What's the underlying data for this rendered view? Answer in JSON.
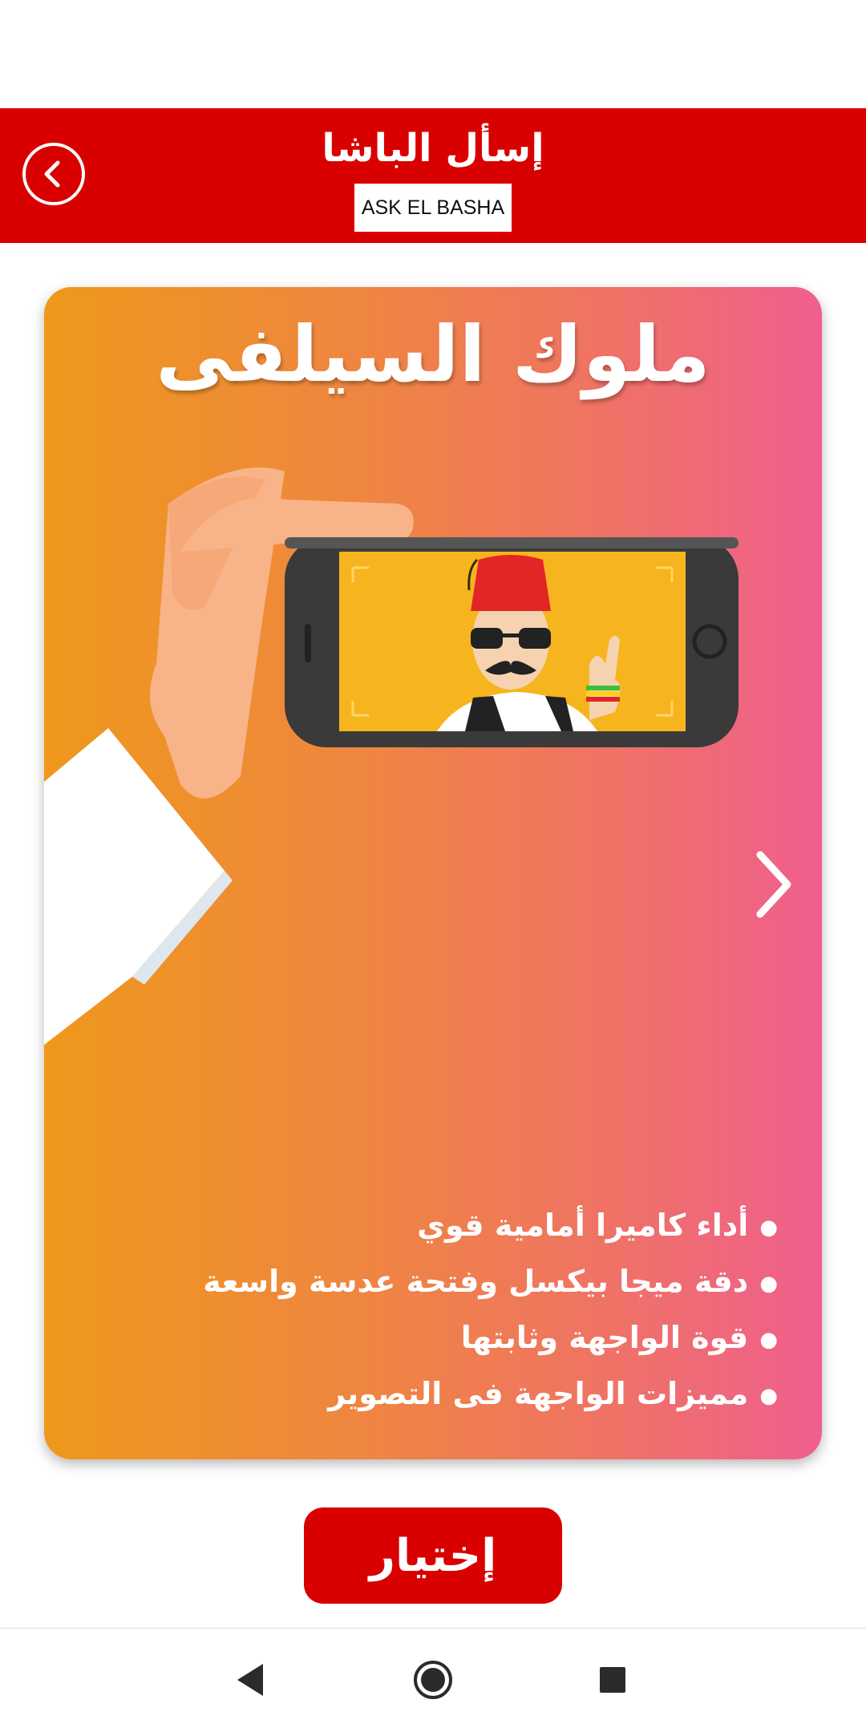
{
  "header": {
    "title": "إسأل الباشا",
    "subtitle": "ASK EL BASHA"
  },
  "card": {
    "title": "ملوك السيلفى",
    "features": [
      "أداء كاميرا أمامية قوي",
      "دقة ميجا بيكسل وفتحة عدسة واسعة",
      "قوة الواجهة وثابتها",
      "مميزات الواجهة فى التصوير"
    ]
  },
  "actions": {
    "choose_label": "إختيار"
  },
  "colors": {
    "brand_red": "#d90000",
    "gradient_start": "#ef981b",
    "gradient_end": "#ef5f8e"
  },
  "icons": {
    "back": "chevron-left-circle-icon",
    "next": "chevron-right-icon",
    "nav_back": "triangle-back-icon",
    "nav_home": "circle-home-icon",
    "nav_recents": "square-recents-icon"
  }
}
